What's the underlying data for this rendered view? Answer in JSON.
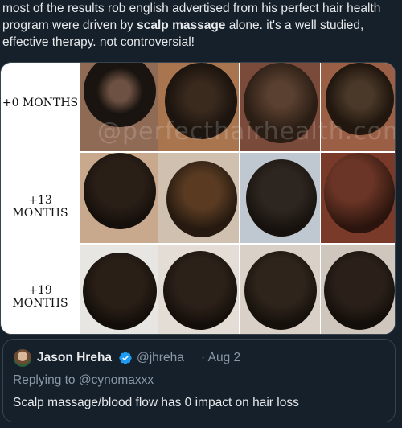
{
  "tweet": {
    "text_before": "most of the results rob english advertised from his perfect hair health program were driven by ",
    "text_bold": "scalp massage",
    "text_after": " alone. it's a well studied, effective therapy. not controversial!"
  },
  "media": {
    "watermark": "@perfecthairhealth.com",
    "rows": [
      {
        "label": "+0 MONTHS"
      },
      {
        "label": "+13 MONTHS"
      },
      {
        "label": "+19 MONTHS"
      }
    ]
  },
  "quote": {
    "name": "Jason Hreha",
    "handle": "@jhreha",
    "separator": "·",
    "date": "Aug 2",
    "replying_prefix": "Replying to ",
    "replying_handle": "@cynomaxxx",
    "text": "Scalp massage/blood flow has 0 impact on hair loss"
  },
  "colors": {
    "background": "#15202b",
    "text": "#e7e9ea",
    "secondary": "#8b98a5",
    "verified": "#1d9bf0",
    "border": "#38444d"
  }
}
